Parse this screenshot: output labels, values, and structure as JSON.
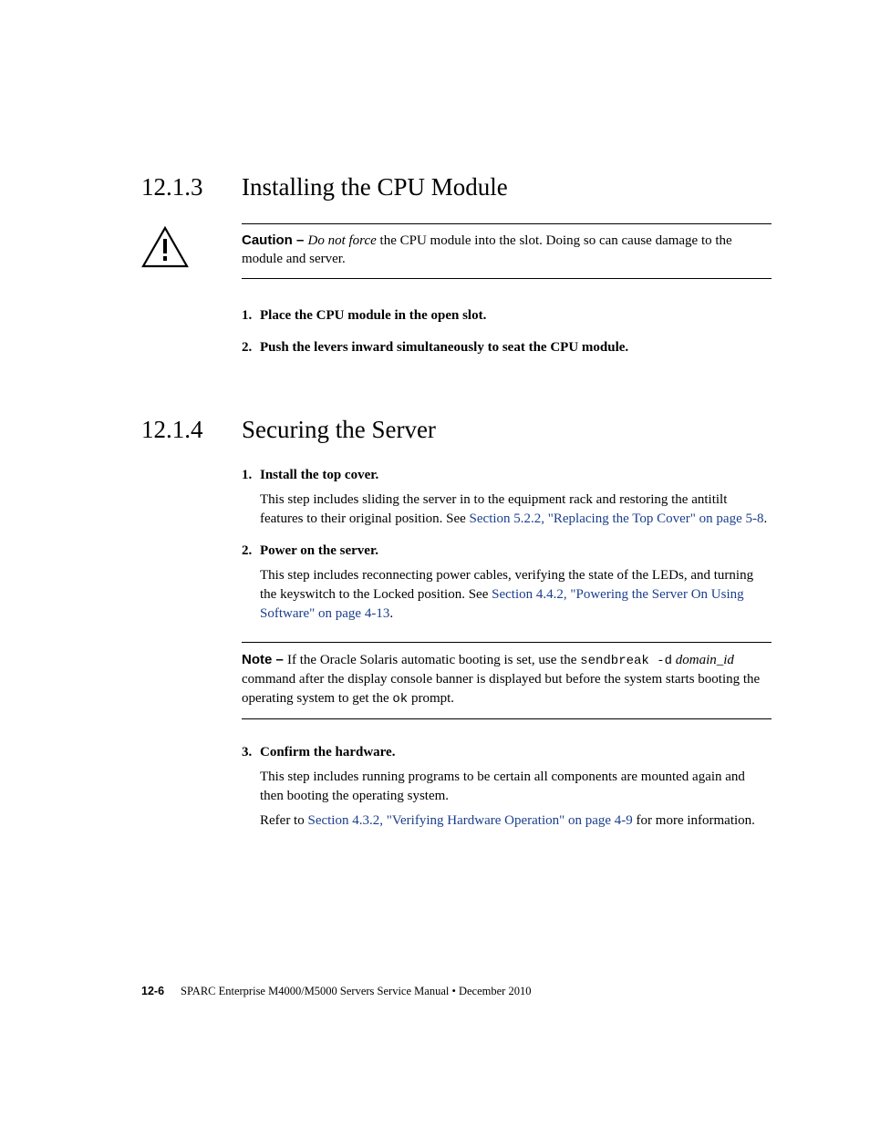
{
  "section1": {
    "number": "12.1.3",
    "title": "Installing the CPU Module",
    "caution": {
      "label": "Caution – ",
      "italic": "Do not force",
      "rest": " the CPU module into the slot. Doing so can cause damage to the module and server."
    },
    "steps": [
      {
        "num": "1.",
        "head": "Place the CPU module in the open slot."
      },
      {
        "num": "2.",
        "head": "Push the levers inward simultaneously to seat the CPU module."
      }
    ]
  },
  "section2": {
    "number": "12.1.4",
    "title": "Securing the Server",
    "steps": [
      {
        "num": "1.",
        "head": "Install the top cover.",
        "body_pre": "This step includes sliding the server in to the equipment rack and restoring the antitilt features to their original position. See ",
        "link": "Section 5.2.2, \"Replacing the Top Cover\" on page 5-8",
        "body_post": "."
      },
      {
        "num": "2.",
        "head": "Power on the server.",
        "body_pre": "This step includes reconnecting power cables, verifying the state of the LEDs, and turning the keyswitch to the Locked position. See ",
        "link": "Section 4.4.2, \"Powering the Server On Using Software\" on page 4-13",
        "body_post": "."
      }
    ],
    "note": {
      "label": "Note – ",
      "pre": "If the Oracle Solaris automatic booting is set, use the ",
      "mono1": "sendbreak -d",
      "mid1": " ",
      "italic": "domain_id",
      "mid2": " command after the display console banner is displayed but before the system starts booting the operating system to get the ",
      "mono2": "ok",
      "post": " prompt."
    },
    "step3": {
      "num": "3.",
      "head": "Confirm the hardware.",
      "body1": "This step includes running programs to be certain all components are mounted again and then booting the operating system.",
      "body2_pre": "Refer to ",
      "link": "Section 4.3.2, \"Verifying Hardware Operation\" on page 4-9",
      "body2_post": " for more information."
    }
  },
  "footer": {
    "page": "12-6",
    "title": "SPARC Enterprise M4000/M5000 Servers Service Manual  •  December 2010"
  }
}
